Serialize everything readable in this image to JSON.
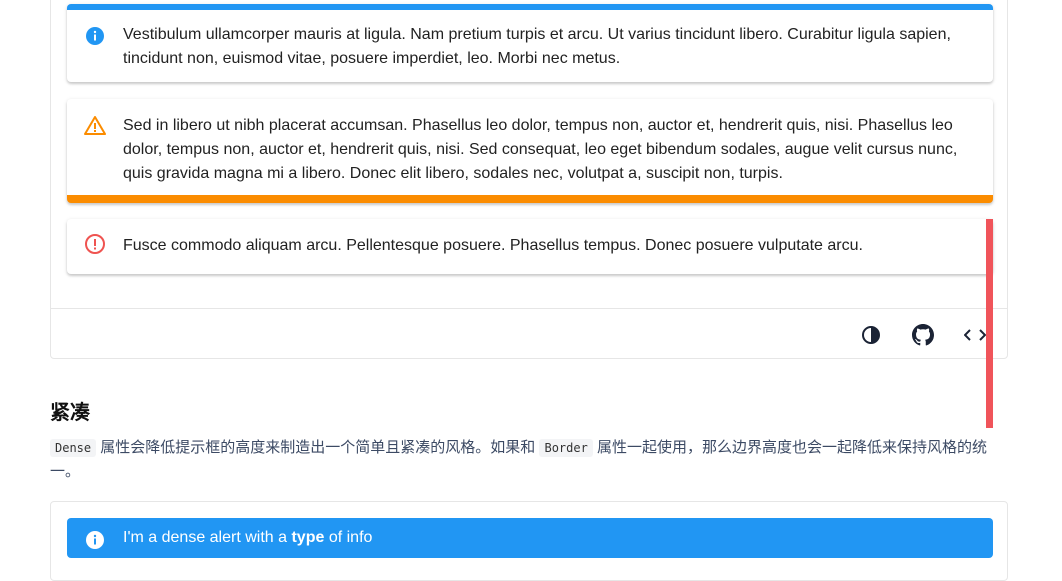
{
  "alerts": {
    "info": {
      "text": "Vestibulum ullamcorper mauris at ligula. Nam pretium turpis et arcu. Ut varius tincidunt libero. Curabitur ligula sapien, tincidunt non, euismod vitae, posuere imperdiet, leo. Morbi nec metus.",
      "icon": "info-circle-icon",
      "color": "#2196f3"
    },
    "warning": {
      "text": "Sed in libero ut nibh placerat accumsan. Phasellus leo dolor, tempus non, auctor et, hendrerit quis, nisi. Phasellus leo dolor, tempus non, auctor et, hendrerit quis, nisi. Sed consequat, leo eget bibendum sodales, augue velit cursus nunc, quis gravida magna mi a libero. Donec elit libero, sodales nec, volutpat a, suscipit non, turpis.",
      "icon": "warning-triangle-icon",
      "color": "#fb8c00"
    },
    "error": {
      "text": "Fusce commodo aliquam arcu. Pellentesque posuere. Phasellus tempus. Donec posuere vulputate arcu.",
      "icon": "error-circle-icon",
      "color": "#ef5350"
    }
  },
  "toolbar": {
    "icons": [
      "invert-colors-icon",
      "github-icon",
      "code-icon"
    ]
  },
  "section": {
    "title": "紧凑",
    "code_dense": "Dense",
    "desc_part1": " 属性会降低提示框的高度来制造出一个简单且紧凑的风格。如果和 ",
    "code_border": "Border",
    "desc_part2": " 属性一起使用，那么边界高度也会一起降低来保持风格的统一。"
  },
  "dense_alert": {
    "prefix": "I'm a dense alert with a ",
    "bold": "type",
    "suffix": " of info",
    "icon": "info-circle-icon",
    "color": "#2196f3"
  }
}
